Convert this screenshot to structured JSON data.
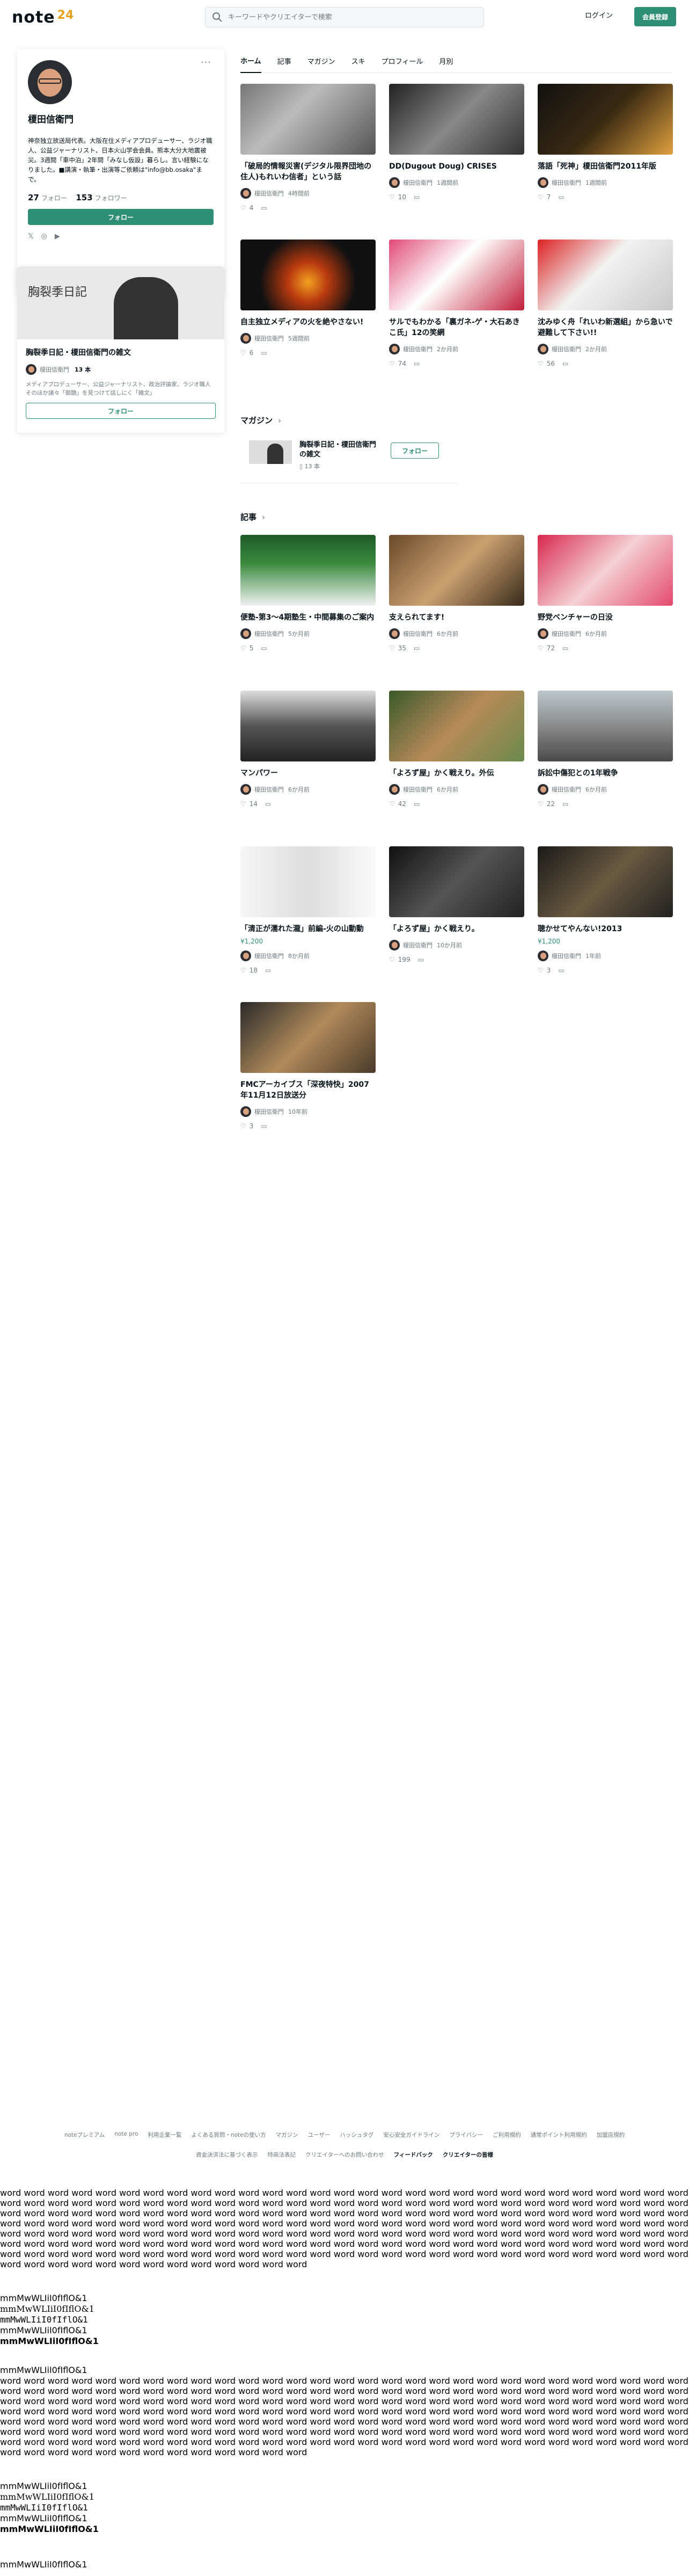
{
  "header": {
    "logo": "note",
    "logo_badge": "24",
    "search_placeholder": "キーワードやクリエイターで検索",
    "login": "ログイン",
    "signup": "会員登録"
  },
  "profile": {
    "name": "榎田信衛門",
    "bio": "神奈独立放送局代表。大阪在住メディアプロデューサー、ラジオ職人、公益ジャーナリスト、日本火山学会会員。熊本大分大地震被災。3週間「車中泊」2年間「みなし仮設」暮らし。言い経験になりました。■講演・執筆・出演等ご依頼は\"info@bb.osaka\"まで。",
    "following_count": "27",
    "following_label": "フォロー",
    "followers_count": "153",
    "followers_label": "フォロワー",
    "follow_button": "フォロー",
    "social": [
      "x-icon",
      "instagram-icon",
      "youtube-icon"
    ]
  },
  "profile_magazine": {
    "title": "胸裂季日記・榎田信衛門の雑文",
    "author": "榎田信衛門",
    "count": "13 本",
    "desc": "メディアプロデューサー、公益ジャーナリスト、政治評論家、ラジオ職人そのほか諸々「御題」を見つけて話しにく「雑文」",
    "follow_button": "フォロー"
  },
  "tabs": [
    "ホーム",
    "記事",
    "マガジン",
    "スキ",
    "プロフィール",
    "月別"
  ],
  "home_articles": [
    {
      "title": "「破局的情報災害(デジタル限界団地の住人)もれいわ信者」という話",
      "author": "榎田信衛門",
      "time": "4時間前",
      "likes": "4",
      "price": ""
    },
    {
      "title": "DD(Dugout Doug) CRISES",
      "author": "榎田信衛門",
      "time": "1週間前",
      "likes": "10",
      "price": ""
    },
    {
      "title": "落語「死神」榎田信衛門2011年版",
      "author": "榎田信衛門",
      "time": "1週間前",
      "likes": "7",
      "price": ""
    },
    {
      "title": "自主独立メディアの火を絶やさない!",
      "author": "榎田信衛門",
      "time": "5週間前",
      "likes": "6",
      "price": ""
    },
    {
      "title": "サルでもわかる「裏ガネ-ゲ・大石あきこ氏」12の笑網",
      "author": "榎田信衛門",
      "time": "2か月前",
      "likes": "74",
      "price": ""
    },
    {
      "title": "沈みゆく舟「れいわ新選組」から急いで避難して下さい!!",
      "author": "榎田信衛門",
      "time": "2か月前",
      "likes": "56",
      "price": ""
    }
  ],
  "magazine_section": {
    "title": "マガジン",
    "name": "胸裂季日記・榎田信衛門の雑文",
    "count": "13 本",
    "follow_button": "フォロー"
  },
  "articles_section_title": "記事",
  "articles": [
    {
      "title": "便塾-第3～4期塾生・中間募集のご案内",
      "author": "榎田信衛門",
      "time": "5か月前",
      "likes": "5",
      "price": ""
    },
    {
      "title": "支えられてます!",
      "author": "榎田信衛門",
      "time": "6か月前",
      "likes": "35",
      "price": ""
    },
    {
      "title": "野党ベンチャーの日没",
      "author": "榎田信衛門",
      "time": "6か月前",
      "likes": "72",
      "price": ""
    },
    {
      "title": "マンパワー",
      "author": "榎田信衛門",
      "time": "6か月前",
      "likes": "14",
      "price": ""
    },
    {
      "title": "「よろず屋」かく戦えり。外伝",
      "author": "榎田信衛門",
      "time": "6か月前",
      "likes": "42",
      "price": ""
    },
    {
      "title": "訴訟中傷犯との1年戦争",
      "author": "榎田信衛門",
      "time": "6か月前",
      "likes": "22",
      "price": ""
    },
    {
      "title": "「清正が濡れた瀧」前編-火の山動動",
      "author": "榎田信衛門",
      "time": "8か月前",
      "likes": "18",
      "price": "¥1,200"
    },
    {
      "title": "「よろず屋」かく戦えり。",
      "author": "榎田信衛門",
      "time": "10か月前",
      "likes": "199",
      "price": ""
    },
    {
      "title": "聴かせてやんない!2013",
      "author": "榎田信衛門",
      "time": "1年前",
      "likes": "3",
      "price": "¥1,200"
    },
    {
      "title": "FMCアーカイブス「深夜特快」2007年11月12日放送分",
      "author": "榎田信衛門",
      "time": "10年前",
      "likes": "3",
      "price": ""
    }
  ],
  "footer": {
    "row1": [
      "noteプレミアム",
      "note pro",
      "利用企業一覧",
      "よくある質問・noteの使い方",
      "マガジン",
      "ユーザー",
      "ハッシュタグ",
      "安心安全ガイドライン",
      "プライバシー",
      "ご利用規約",
      "通常ポイント利用規約",
      "加盟店規約"
    ],
    "row2": [
      "資金決済法に基づく表示",
      "特商法表記",
      "クリエイターへのお問い合わせ",
      "フィードバック",
      "クリエイターの皆様"
    ]
  },
  "filler_text": "word word word word word word word word word word word word word word word word word word word word word word word word word word word word word word word word word word word word word word word word word word word word word word word word word word word word word word word word word word word word word word word word word word word word word word word word word word word word word word word word word word word word word word word word word word word word word word word word word word word word word word word word word word word word word word word word word word word word word word word word word word word word word word word word word word word word word word word word word word word word word word word word word word word word word word word word word word word word word word word word word word word word word word word word word word word word word word word word word word word word word word word word word word word word word word word word word word word word word word word word word word word word word word word word word word word word word word word word",
  "probe_text": "mmMwWLIiI0fIflO&1"
}
